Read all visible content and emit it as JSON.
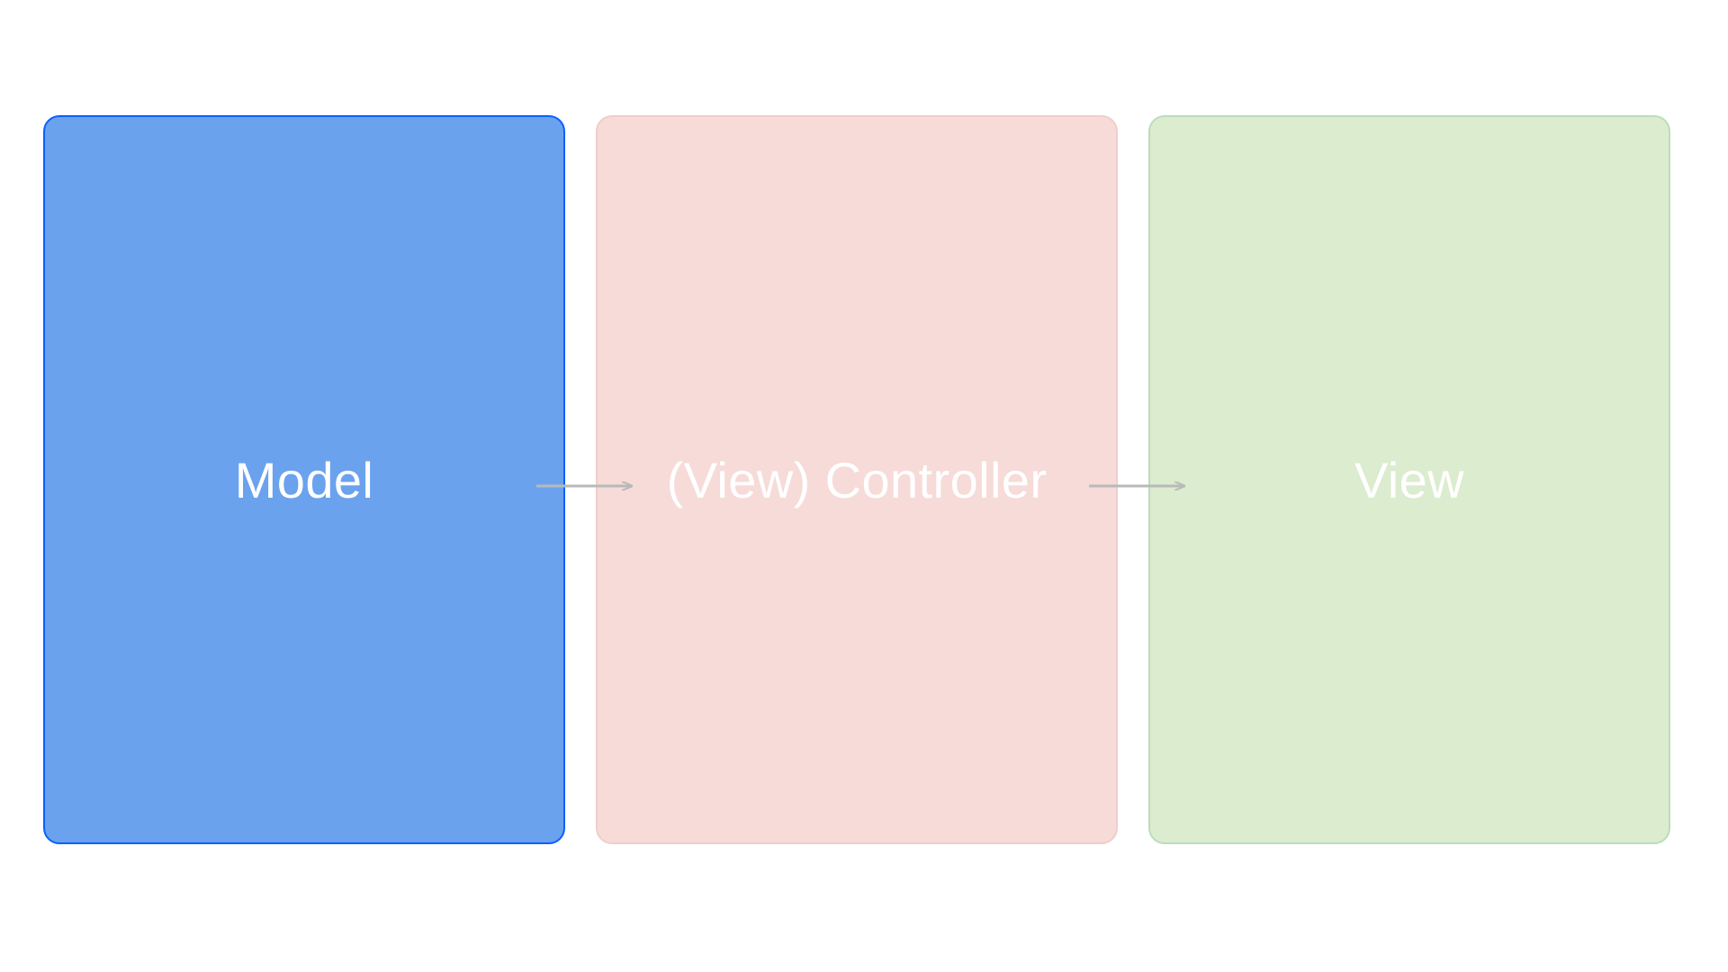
{
  "diagram": {
    "boxes": {
      "model": {
        "label": "Model",
        "fill": "#6aa2ee",
        "stroke": "#0a60ff"
      },
      "controller": {
        "label": "(View) Controller",
        "fill": "#f6dbd8",
        "stroke": "#f1cec9"
      },
      "view": {
        "label": "View",
        "fill": "#dcecce",
        "stroke": "#bcdcbc"
      }
    },
    "arrows": [
      {
        "from": "model",
        "to": "controller"
      },
      {
        "from": "controller",
        "to": "view"
      }
    ],
    "colors": {
      "label_text": "#ffffff",
      "arrow": "#b9b9b9"
    }
  }
}
